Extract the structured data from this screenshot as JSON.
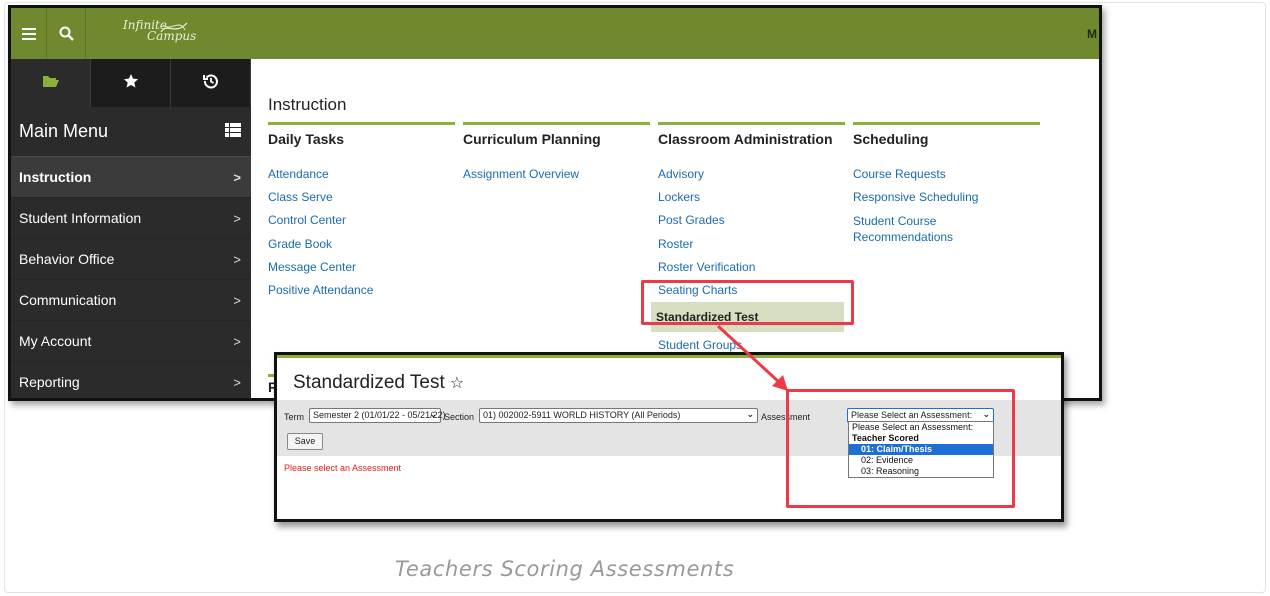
{
  "brand": {
    "logo_line1": "Infinite",
    "logo_line2": "Campus",
    "top_right": "M"
  },
  "sidebar": {
    "title": "Main Menu",
    "items": [
      {
        "label": "Instruction"
      },
      {
        "label": "Student Information"
      },
      {
        "label": "Behavior Office"
      },
      {
        "label": "Communication"
      },
      {
        "label": "My Account"
      },
      {
        "label": "Reporting"
      }
    ]
  },
  "main": {
    "title": "Instruction",
    "columns": [
      {
        "heading": "Daily Tasks",
        "links": [
          "Attendance",
          "Class Serve",
          "Control Center",
          "Grade Book",
          "Message Center",
          "Positive Attendance"
        ]
      },
      {
        "heading": "Curriculum Planning",
        "links": [
          "Assignment Overview"
        ]
      },
      {
        "heading": "Classroom Administration",
        "links": [
          "Advisory",
          "Lockers",
          "Post Grades",
          "Roster",
          "Roster Verification",
          "Seating Charts",
          "Standardized Test",
          "Student Groups"
        ]
      },
      {
        "heading": "Scheduling",
        "links": [
          "Course Requests",
          "Responsive Scheduling",
          "Student Course Recommendations"
        ]
      }
    ],
    "lower_heading_initial": "R"
  },
  "popup": {
    "title": "Standardized Test",
    "star": "☆",
    "term_label": "Term",
    "term_value": "Semester 2 (01/01/22 - 05/21/22)",
    "section_label": "Section",
    "section_value": "01) 002002-5911 WORLD HISTORY (All Periods)",
    "assessment_label": "Assessment",
    "assessment_value": "Please Select an Assessment:",
    "save_label": "Save",
    "error": "Please select an Assessment",
    "dropdown": {
      "placeholder": "Please Select an Assessment:",
      "group": "Teacher Scored",
      "options": [
        "01: Claim/Thesis",
        "02: Evidence",
        "03: Reasoning"
      ],
      "selected_index": 0
    }
  },
  "caption": "Teachers Scoring Assessments",
  "colors": {
    "topbar": "#6f8a2e",
    "accent_green": "#8bb13b",
    "highlight_red": "#ee3a47",
    "link_blue": "#1b6bb0",
    "dropdown_selected": "#1d6fd6"
  }
}
